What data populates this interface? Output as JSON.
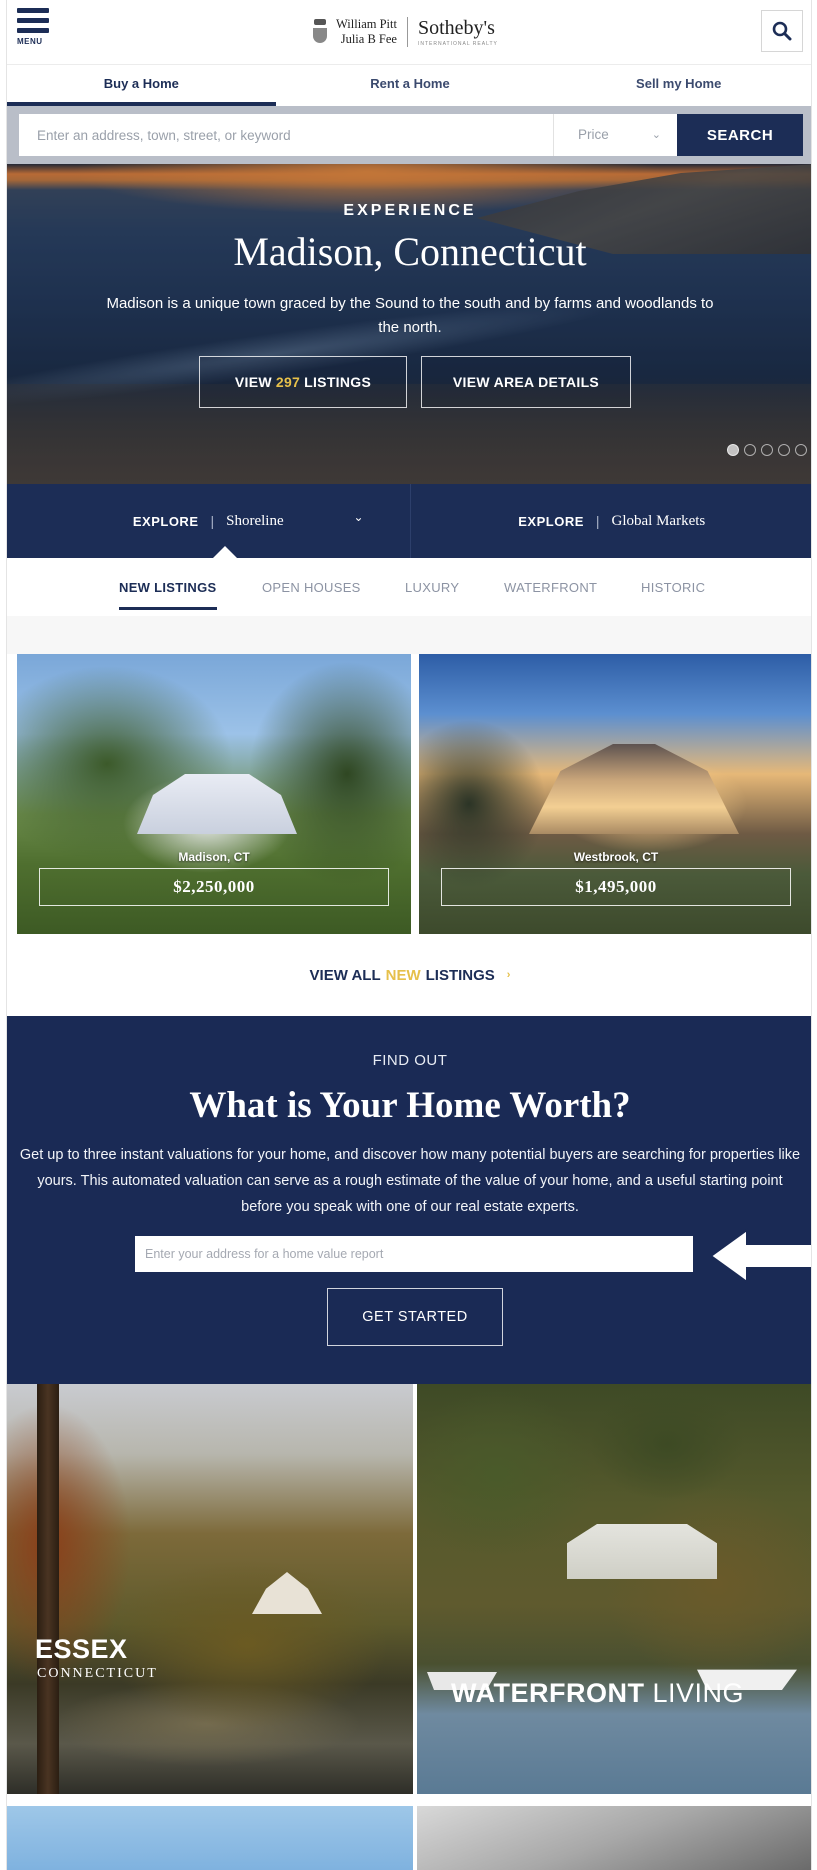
{
  "header": {
    "menu_label": "MENU",
    "logo_name_1": "William Pitt",
    "logo_name_2": "Julia B Fee",
    "logo_brand": "Sotheby's",
    "logo_brand_sub": "INTERNATIONAL REALTY",
    "icons": {
      "menu": "hamburger-icon",
      "search": "search-icon"
    }
  },
  "nav": {
    "tabs": [
      "Buy a Home",
      "Rent a Home",
      "Sell my Home"
    ],
    "active": "Buy a Home"
  },
  "search": {
    "placeholder": "Enter an address, town, street, or keyword",
    "price_label": "Price",
    "submit_label": "SEARCH"
  },
  "hero": {
    "eyebrow": "EXPERIENCE",
    "title": "Madison, Connecticut",
    "description": "Madison is a unique town graced by the Sound to the south and by farms and woodlands to the north.",
    "listings_prefix": "VIEW",
    "listings_count": "297",
    "listings_suffix": "LISTINGS",
    "area_button": "VIEW AREA DETAILS",
    "slides": 5,
    "active_slide": 1
  },
  "explore": {
    "items": [
      {
        "label": "EXPLORE",
        "value": "Shoreline"
      },
      {
        "label": "EXPLORE",
        "value": "Global Markets"
      }
    ]
  },
  "listing_tabs": [
    "NEW LISTINGS",
    "OPEN HOUSES",
    "LUXURY",
    "WATERFRONT",
    "HISTORIC"
  ],
  "listing_tabs_active": "NEW LISTINGS",
  "listings": [
    {
      "city": "Madison, CT",
      "price": "$2,250,000"
    },
    {
      "city": "Westbrook, CT",
      "price": "$1,495,000"
    }
  ],
  "view_all": {
    "prefix": "VIEW ALL",
    "highlight": "NEW",
    "suffix": "LISTINGS",
    "arrow": "›"
  },
  "home_worth": {
    "eyebrow": "FIND OUT",
    "title": "What is Your Home Worth?",
    "description": "Get up to three instant valuations for your home, and discover how many potential buyers are searching for properties like yours. This automated valuation can serve as a rough estimate of the value of your home, and a useful starting point before you speak with one of our real estate experts.",
    "input_placeholder": "Enter your address for a home value report",
    "button_label": "GET STARTED"
  },
  "features": [
    {
      "title": "ESSEX",
      "subtitle": "CONNECTICUT"
    },
    {
      "title_bold": "WATERFRONT",
      "title_rest": "LIVING"
    }
  ],
  "colors": {
    "navy": "#1c2d56",
    "gold": "#e6c04a",
    "search_bar": "#b9bec8"
  }
}
